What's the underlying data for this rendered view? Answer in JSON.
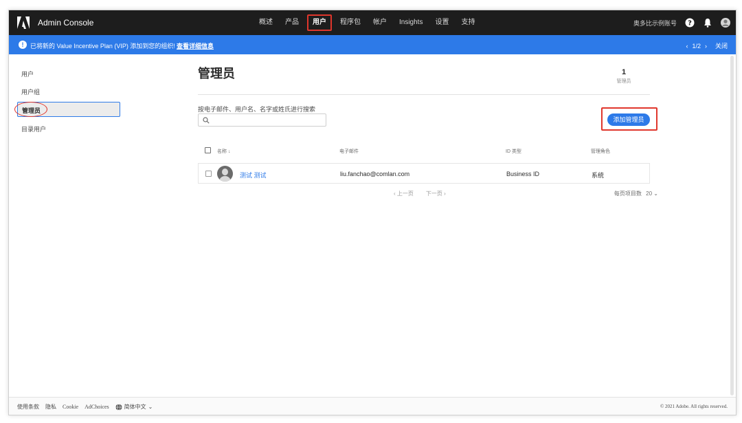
{
  "header": {
    "app_title": "Admin Console",
    "nav": [
      {
        "label": "概述",
        "active": false
      },
      {
        "label": "产品",
        "active": false
      },
      {
        "label": "用户",
        "active": true
      },
      {
        "label": "程序包",
        "active": false
      },
      {
        "label": "帐户",
        "active": false
      },
      {
        "label": "Insights",
        "active": false
      },
      {
        "label": "设置",
        "active": false
      },
      {
        "label": "支持",
        "active": false
      }
    ],
    "org_name": "奥多比示例账号",
    "icons": [
      "help-icon",
      "bell-icon",
      "user-avatar-icon"
    ]
  },
  "banner": {
    "text": "已将新的 Value Incentive Plan (VIP) 添加到您的组织!",
    "link": "查看详细信息",
    "pager": "1/2",
    "close": "关闭"
  },
  "sidebar": {
    "items": [
      {
        "label": "用户",
        "selected": false
      },
      {
        "label": "用户组",
        "selected": false
      },
      {
        "label": "管理员",
        "selected": true
      },
      {
        "label": "目录用户",
        "selected": false
      }
    ]
  },
  "main": {
    "title": "管理员",
    "count": "1",
    "count_label": "管理员",
    "search_label": "按电子邮件、用户名、名字或姓氏进行搜索",
    "search_value": "",
    "add_button": "添加管理员",
    "columns": [
      "名称",
      "电子邮件",
      "ID 类型",
      "管理角色"
    ],
    "rows": [
      {
        "name": "测试 测试",
        "email": "liu.fanchao@comlan.com",
        "id_type": "Business ID",
        "role": "系统"
      }
    ],
    "prev": "‹ 上一页",
    "next": "下一页 ›",
    "per_page_label": "每页项目数",
    "per_page_value": "20"
  },
  "footer": {
    "links": [
      "使用条款",
      "隐私",
      "Cookie",
      "AdChoices"
    ],
    "language": "简体中文",
    "copyright": "© 2021 Adobe. All rights reserved."
  },
  "colors": {
    "topbar": "#1d1d1d",
    "banner": "#2d7ae8",
    "accent": "#2d7ae8",
    "highlight": "#e0362c"
  }
}
